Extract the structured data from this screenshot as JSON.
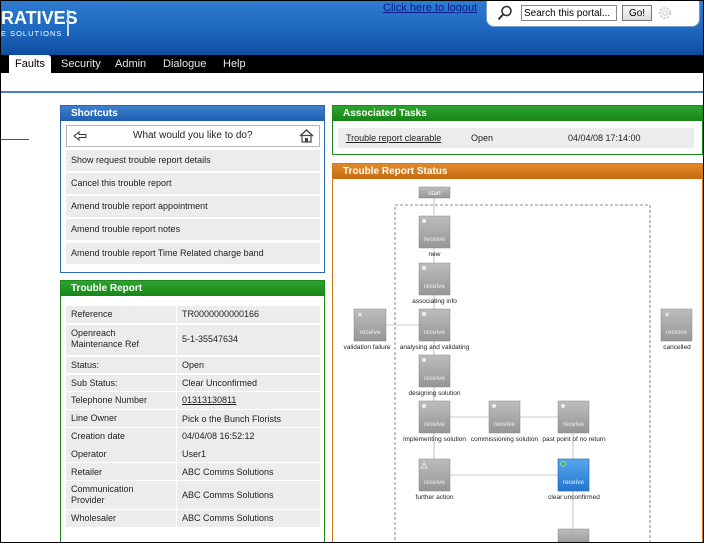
{
  "header": {
    "logo_line1": "RATIVES",
    "logo_line2": "E SOLUTIONS",
    "logout_link": "Click here to logout",
    "search_value": "Search this portal...",
    "go_button": "Go!",
    "colors": {
      "header_blue": "#1d67bf",
      "nav_black": "#000000"
    }
  },
  "nav": {
    "items": [
      {
        "label": "Faults",
        "active": true
      },
      {
        "label": "Security"
      },
      {
        "label": "Admin"
      },
      {
        "label": "Dialogue"
      },
      {
        "label": "Help"
      }
    ]
  },
  "shortcuts": {
    "title": "Shortcuts",
    "question": "What would you like to do?",
    "back_icon": "back-arrow-icon",
    "home_icon": "home-icon",
    "items": [
      "Show request trouble report details",
      "Cancel this trouble report",
      "Amend trouble report appointment",
      "Amend trouble report notes",
      "Amend trouble report Time Related charge band"
    ]
  },
  "trouble_report": {
    "title": "Trouble Report",
    "rows": [
      {
        "label": "Reference",
        "value": "TR0000000000166"
      },
      {
        "label": "Openreach Maintenance Ref",
        "value": "5-1-35547634"
      },
      {
        "label": "Status:",
        "value": "Open"
      },
      {
        "label": "Sub Status:",
        "value": "Clear Unconfirmed"
      },
      {
        "label": "Telephone Number",
        "value": "01313130811",
        "link": true
      },
      {
        "label": "Line Owner",
        "value": "Pick o the Bunch Florists"
      },
      {
        "label": "Creation date",
        "value": "04/04/08 16:52:12"
      },
      {
        "label": "Operator",
        "value": "User1"
      },
      {
        "label": "Retailer",
        "value": "ABC Comms Solutions"
      },
      {
        "label": "Communication Provider",
        "value": "ABC Comms Solutions"
      },
      {
        "label": "Wholesaler",
        "value": "ABC Comms Solutions"
      }
    ]
  },
  "tasks": {
    "title": "Associated Tasks",
    "row": {
      "name": "Trouble report clearable",
      "status": "Open",
      "date": "04/04/08 17:14:00"
    }
  },
  "status": {
    "title": "Trouble Report Status",
    "start_label": "start",
    "node_text": "receive",
    "nodes": {
      "new": "new",
      "associating": "associating info",
      "analysing": "analysing and validating",
      "validation_failure": "validation failure",
      "cancelled": "cancelled",
      "designing": "designing solution",
      "implementing": "implementing solution",
      "commissioning": "commissioning solution",
      "ponr": "past point of no return",
      "further_action": "further action",
      "clear_unconfirmed": "clear unconfirmed"
    },
    "current_node": "clear unconfirmed",
    "colors": {
      "node_gray": "#a8a8a8",
      "node_current": "#2f86dd"
    }
  }
}
